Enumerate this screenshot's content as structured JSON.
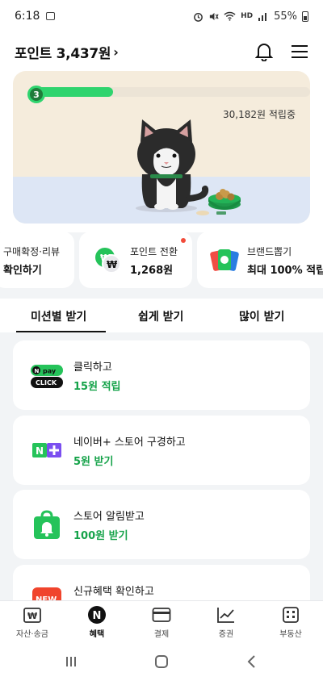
{
  "status": {
    "time": "6:18",
    "battery": "55%",
    "network": "HD"
  },
  "header": {
    "title": "포인트 3,437원",
    "chevron": "›"
  },
  "hero": {
    "level": "3",
    "progress_fraction": 0.3,
    "accumulating_text": "30,182원 적립중"
  },
  "quick_cards": [
    {
      "line1": "구매확정·리뷰",
      "line2": "확인하기"
    },
    {
      "line1": "포인트 전환",
      "line2": "1,268원"
    },
    {
      "line1": "브랜드뽑기",
      "line2": "최대 100% 적립"
    }
  ],
  "tabs": [
    {
      "label": "미션별 받기"
    },
    {
      "label": "쉽게 받기"
    },
    {
      "label": "많이 받기"
    }
  ],
  "missions": [
    {
      "title": "클릭하고",
      "reward": "15원 적립",
      "icon": "npay-click-icon",
      "icon_text": "CLICK"
    },
    {
      "title": "네이버+ 스토어 구경하고",
      "reward": "5원 받기",
      "icon": "naver-plus-icon"
    },
    {
      "title": "스토어 알림받고",
      "reward": "100원 받기",
      "icon": "store-bell-icon"
    },
    {
      "title": "신규혜택 확인하고",
      "reward": "",
      "icon": "new-badge-icon",
      "icon_text": "NEW"
    }
  ],
  "bottom_nav": [
    {
      "label": "자산·송금"
    },
    {
      "label": "혜택"
    },
    {
      "label": "결제"
    },
    {
      "label": "증권"
    },
    {
      "label": "부동산"
    }
  ],
  "colors": {
    "accent_green": "#16a34a",
    "progress_green": "#2fd46e",
    "new_red": "#f0442c"
  }
}
